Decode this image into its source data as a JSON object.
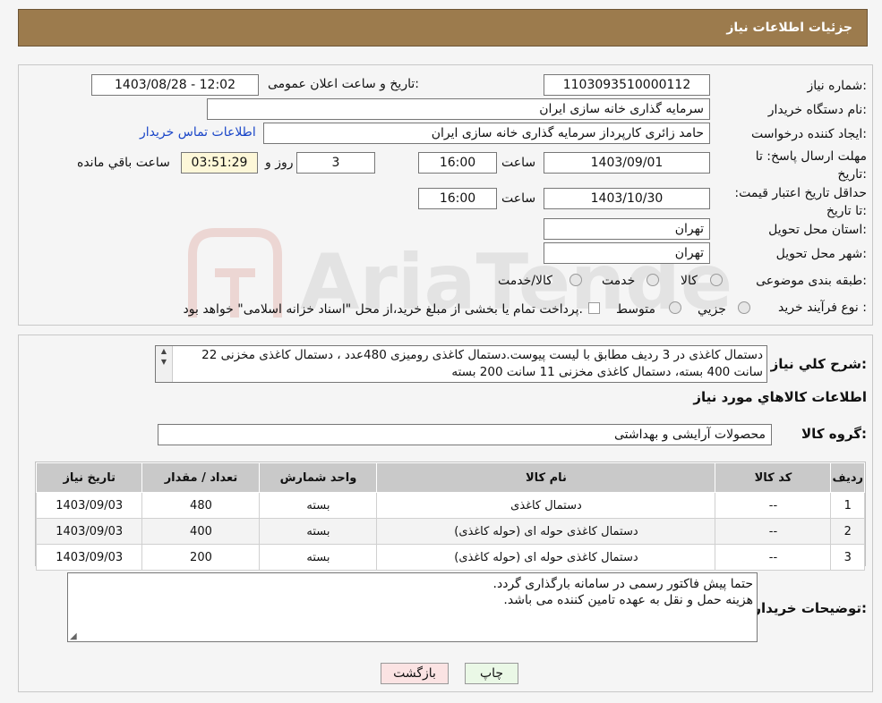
{
  "header": {
    "title": "جزئیات اطلاعات نیاز"
  },
  "need_number": {
    "label": "شماره نیاز:",
    "value": "1103093510000112"
  },
  "announce": {
    "label": "تاریخ و ساعت اعلان عمومی:",
    "value": "1403/08/28 - 12:02"
  },
  "buyer_org": {
    "label": "نام دستگاه خریدار:",
    "value": "سرمایه گذاری خانه سازی ایران"
  },
  "requester": {
    "label": "ایجاد کننده درخواست:",
    "value": "حامد زائری کارپرداز سرمایه گذاری خانه سازی ایران",
    "contact_link": "اطلاعات تماس خریدار"
  },
  "deadline": {
    "label": "مهلت ارسال پاسخ: تا تاریخ:",
    "date": "1403/09/01",
    "time_label": "ساعت",
    "time": "16:00",
    "days": "3",
    "days_label": "روز و",
    "remaining": "03:51:29",
    "remaining_label": "ساعت باقي مانده"
  },
  "validity": {
    "label": "حداقل تاریخ اعتبار قیمت: تا تاریخ:",
    "date": "1403/10/30",
    "time_label": "ساعت",
    "time": "16:00"
  },
  "province": {
    "label": "استان محل تحویل:",
    "value": "تهران"
  },
  "city": {
    "label": "شهر محل تحویل:",
    "value": "تهران"
  },
  "category": {
    "label": "طبقه بندی موضوعی:",
    "options": [
      "کالا",
      "خدمت",
      "کالا/خدمت"
    ]
  },
  "purchase_type": {
    "label": "نوع فرآیند خرید :",
    "options": [
      "جزیي",
      "متوسط"
    ],
    "note": "پرداخت تمام یا بخشی از مبلغ خرید،از محل \"اسناد خزانه اسلامی\" خواهد بود."
  },
  "description": {
    "label": "شرح کلي نياز:",
    "text": "دستمال کاغذی در 3 ردیف مطابق با لیست پیوست.دستمال کاغذی رومیزی 480عدد ، دستمال کاغذی مخزنی 22 سانت 400 بسته، دستمال کاغذی مخزنی 11 سانت 200 بسته"
  },
  "items_section": {
    "title": "اطلاعات كالاهاي مورد نياز"
  },
  "goods_group": {
    "label": "گروه کالا:",
    "value": "محصولات آرایشی و بهداشتی"
  },
  "table": {
    "headers": [
      "ردیف",
      "کد کالا",
      "نام کالا",
      "واحد شمارش",
      "تعداد / مقدار",
      "تاریخ نیاز"
    ],
    "rows": [
      [
        "1",
        "--",
        "دستمال کاغذی",
        "بسته",
        "480",
        "1403/09/03"
      ],
      [
        "2",
        "--",
        "دستمال کاغذی حوله ای (حوله کاغذی)",
        "بسته",
        "400",
        "1403/09/03"
      ],
      [
        "3",
        "--",
        "دستمال کاغذی حوله ای (حوله کاغذی)",
        "بسته",
        "200",
        "1403/09/03"
      ]
    ]
  },
  "buyer_notes": {
    "label": "توضیحات خریدار:",
    "line1": "حتما پیش فاکتور رسمی در سامانه بارگذاری گردد.",
    "line2": "هزینه حمل و نقل به عهده تامین کننده می باشد."
  },
  "buttons": {
    "print": "چاپ",
    "back": "بازگشت"
  },
  "watermark": {
    "text": "AriaTender.neT"
  },
  "colors": {
    "header_bg": "#9c7b4d",
    "link": "#1a46c8",
    "print_btn": "#eaf8e6",
    "back_btn": "#fbe3e3"
  }
}
